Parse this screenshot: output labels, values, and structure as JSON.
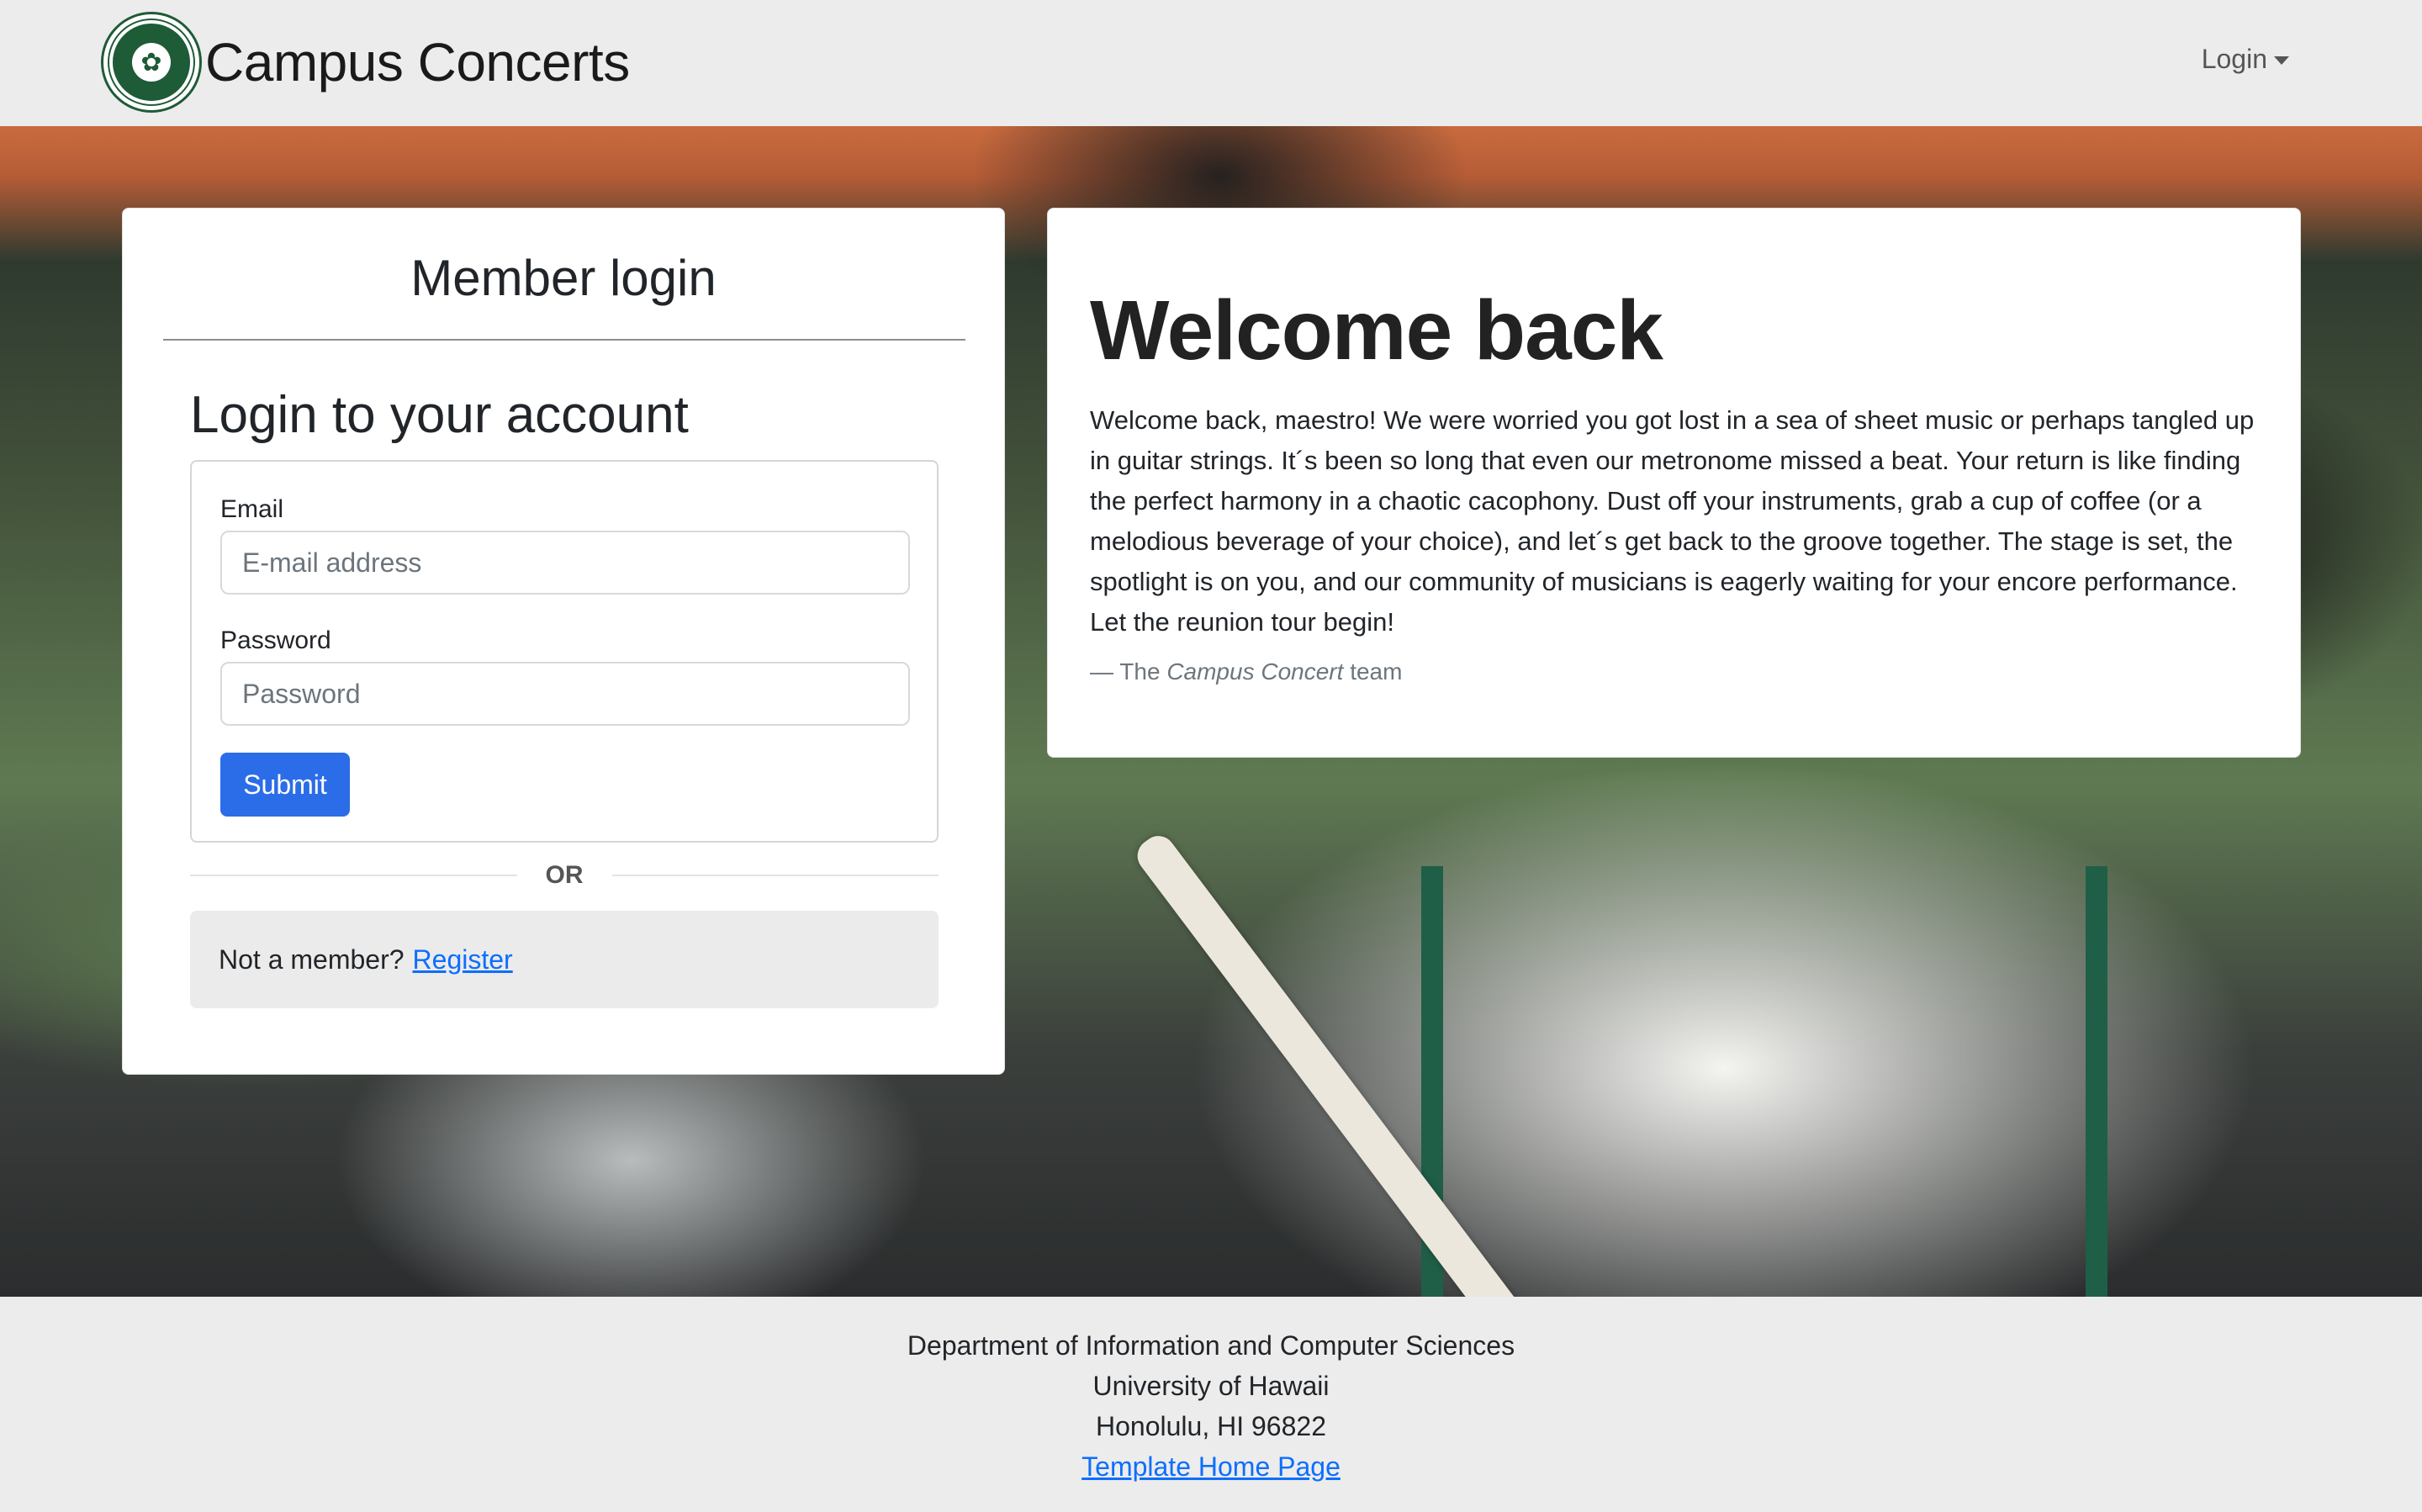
{
  "navbar": {
    "brand_title": "Campus Concerts",
    "logo_icon": "university-seal-icon",
    "login_dropdown_label": "Login"
  },
  "login_card": {
    "title": "Member login",
    "subtitle": "Login to your account",
    "email_label": "Email",
    "email_placeholder": "E-mail address",
    "email_value": "",
    "password_label": "Password",
    "password_placeholder": "Password",
    "password_value": "",
    "submit_label": "Submit",
    "or_text": "OR",
    "register_prompt": "Not a member?",
    "register_link": "Register"
  },
  "welcome_card": {
    "title": "Welcome back",
    "text": "Welcome back, maestro! We were worried you got lost in a sea of sheet music or perhaps tangled up in guitar strings. It´s been so long that even our metronome missed a beat. Your return is like finding the perfect harmony in a chaotic cacophony. Dust off your instruments, grab a cup of coffee (or a melodious beverage of your choice), and let´s get back to the groove together. The stage is set, the spotlight is on you, and our community of musicians is eagerly waiting for your encore performance. Let the reunion tour begin!",
    "signoff_prefix": "— The",
    "signoff_name": "Campus Concert",
    "signoff_suffix": "team"
  },
  "footer": {
    "line1": "Department of Information and Computer Sciences",
    "line2": "University of Hawaii",
    "line3": "Honolulu, HI 96822",
    "link": "Template Home Page"
  },
  "colors": {
    "primary": "#2b6de8",
    "link": "#0d6efd",
    "navbar_bg": "#ececec",
    "seal_green": "#1e5b37"
  }
}
